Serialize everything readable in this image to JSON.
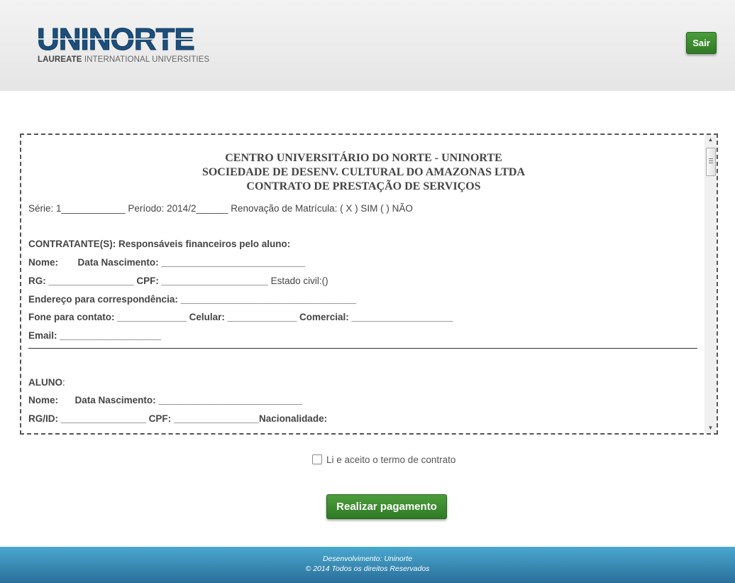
{
  "header": {
    "logo_word": "UNINORTE",
    "logo_sub_bold": "LAUREATE",
    "logo_sub": " INTERNATIONAL UNIVERSITIES",
    "logout_label": "Sair"
  },
  "contract": {
    "heading_1": "CENTRO UNIVERSITÁRIO DO NORTE - UNINORTE",
    "heading_2": "SOCIEDADE DE DESENV. CULTURAL DO AMAZONAS LTDA",
    "heading_3": "CONTRATO DE PRESTAÇÃO DE SERVIÇOS",
    "serie_line": "Série: 1____________ Período: 2014/2______ Renovação de Matrícula: ( X ) SIM ( ) NÃO",
    "contratante_title": "CONTRATANTE(S): Responsáveis financeiros pelo aluno:",
    "c_nome": "Nome:",
    "c_nascimento": "Data Nascimento: ___________________________",
    "c_rg": "RG: ________________",
    "c_cpf": "CPF: ____________________",
    "c_estado_civil": "Estado civil:()",
    "c_endereco": "Endereço para correspondência: _________________________________",
    "c_fone": "Fone para contato: _____________",
    "c_celular": "Celular: _____________",
    "c_comercial": "Comercial: ___________________",
    "c_email": "Email:",
    "c_email_blank": " ___________________",
    "aluno_title": "ALUNO",
    "aluno_colon": ":",
    "a_nome": "Nome:",
    "a_nascimento": "Data Nascimento: ___________________________",
    "a_rg": "RG/ID: ________________",
    "a_cpf": "CPF: ________________",
    "a_nacionalidade": "Nacionalidade:"
  },
  "accept_label": "Li e aceito o termo de contrato",
  "pay_label": "Realizar pagamento",
  "footer": {
    "line1": "Desenvolvimento: Uninorte",
    "line2": "© 2014 Todos os direitos Reservados"
  },
  "colors": {
    "brand_blue": "#1d4f7c",
    "button_green": "#3a8a2e",
    "footer_blue": "#3a8fbd"
  }
}
